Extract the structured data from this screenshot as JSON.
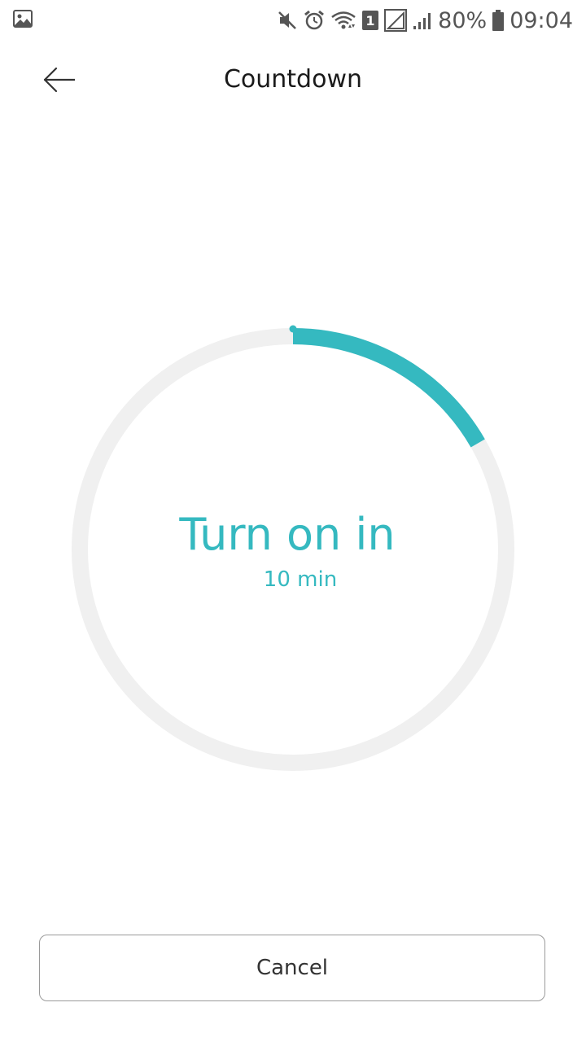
{
  "status_bar": {
    "battery": "80%",
    "time": "09:04",
    "sim_badge": "1",
    "icons": [
      "gallery-icon",
      "mute-icon",
      "alarm-icon",
      "wifi-icon",
      "sim-icon",
      "signal-icon",
      "signal-bars-icon",
      "battery-icon"
    ]
  },
  "header": {
    "title": "Countdown",
    "back_icon": "arrow-left-icon"
  },
  "countdown": {
    "label": "Turn on in",
    "value": "10 min",
    "progress": 0.167,
    "colors": {
      "accent": "#35b9c0",
      "track": "#f0f0f0"
    }
  },
  "actions": {
    "cancel_label": "Cancel"
  }
}
